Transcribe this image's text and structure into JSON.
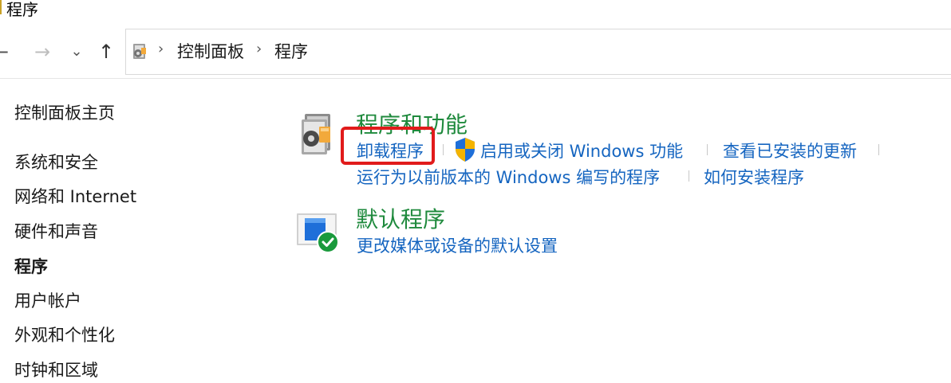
{
  "window": {
    "title": "程序"
  },
  "nav": {
    "back": "←",
    "forward": "→",
    "recent": "⌄",
    "up": "↑"
  },
  "address": {
    "icon": "control-panel-icon",
    "separator": "›",
    "crumbs": [
      "控制面板",
      "程序"
    ]
  },
  "sidebar": {
    "items": [
      {
        "label": "控制面板主页",
        "active": false
      },
      {
        "label": "系统和安全",
        "active": false
      },
      {
        "label": "网络和 Internet",
        "active": false
      },
      {
        "label": "硬件和声音",
        "active": false
      },
      {
        "label": "程序",
        "active": true
      },
      {
        "label": "用户帐户",
        "active": false
      },
      {
        "label": "外观和个性化",
        "active": false
      },
      {
        "label": "时钟和区域",
        "active": false
      }
    ]
  },
  "categories": [
    {
      "title": "程序和功能",
      "icon": "programs-features-icon",
      "links": [
        "卸载程序",
        "启用或关闭 Windows 功能",
        "查看已安装的更新",
        "运行为以前版本的 Windows 编写的程序",
        "如何安装程序"
      ],
      "shield_icon": "uac-shield-icon"
    },
    {
      "title": "默认程序",
      "icon": "default-programs-icon",
      "links": [
        "更改媒体或设备的默认设置"
      ]
    }
  ],
  "colors": {
    "category_title": "#1f8a3d",
    "link": "#1565c0",
    "highlight": "#e11b1b"
  }
}
